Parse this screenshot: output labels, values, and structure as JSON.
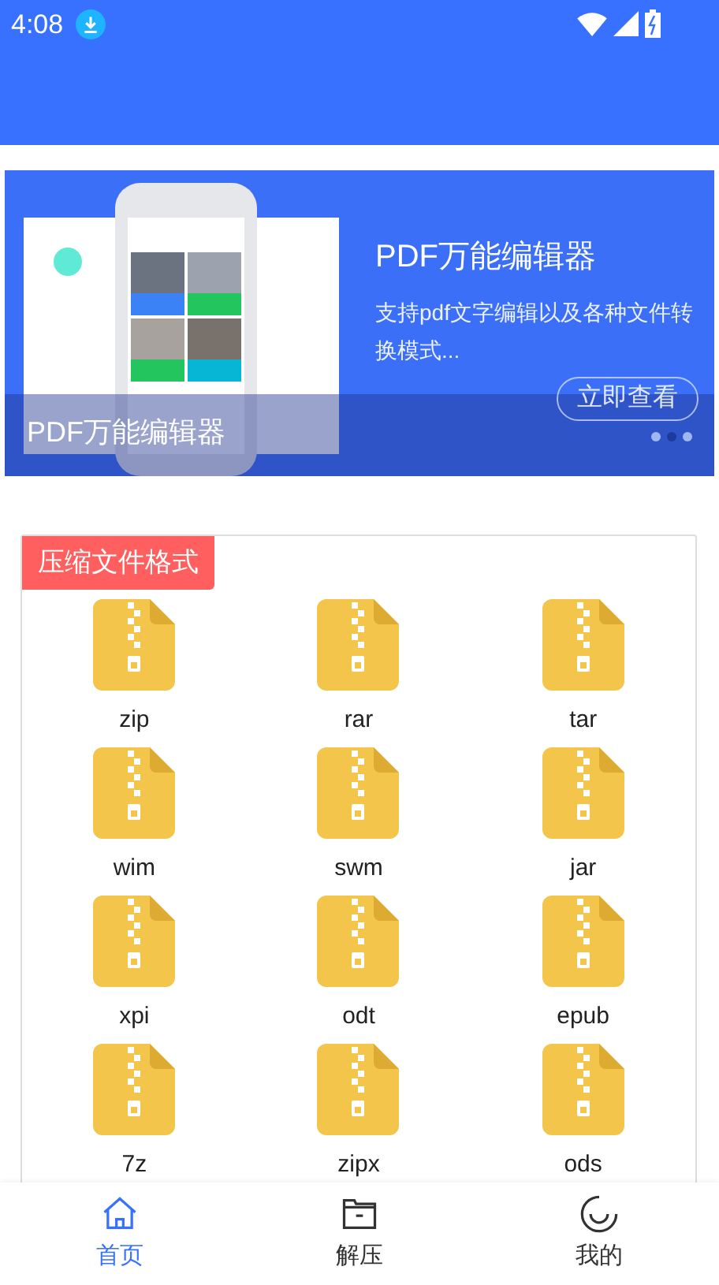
{
  "status_bar": {
    "time": "4:08"
  },
  "banner": {
    "title": "PDF万能编辑器",
    "description": "支持pdf文字编辑以及各种文件转换模式...",
    "button": "立即查看",
    "caption": "PDF万能编辑器",
    "dots": [
      {
        "selected": false
      },
      {
        "selected": true
      },
      {
        "selected": false
      }
    ]
  },
  "section": {
    "title": "压缩文件格式",
    "files": [
      {
        "label": "zip"
      },
      {
        "label": "rar"
      },
      {
        "label": "tar"
      },
      {
        "label": "wim"
      },
      {
        "label": "swm"
      },
      {
        "label": "jar"
      },
      {
        "label": "xpi"
      },
      {
        "label": "odt"
      },
      {
        "label": "epub"
      },
      {
        "label": "7z"
      },
      {
        "label": "zipx"
      },
      {
        "label": "ods"
      }
    ]
  },
  "tabs": [
    {
      "kind": "home",
      "label": "首页",
      "selected": true
    },
    {
      "kind": "folder",
      "label": "解压",
      "selected": false
    },
    {
      "kind": "profile",
      "label": "我的",
      "selected": false
    }
  ]
}
